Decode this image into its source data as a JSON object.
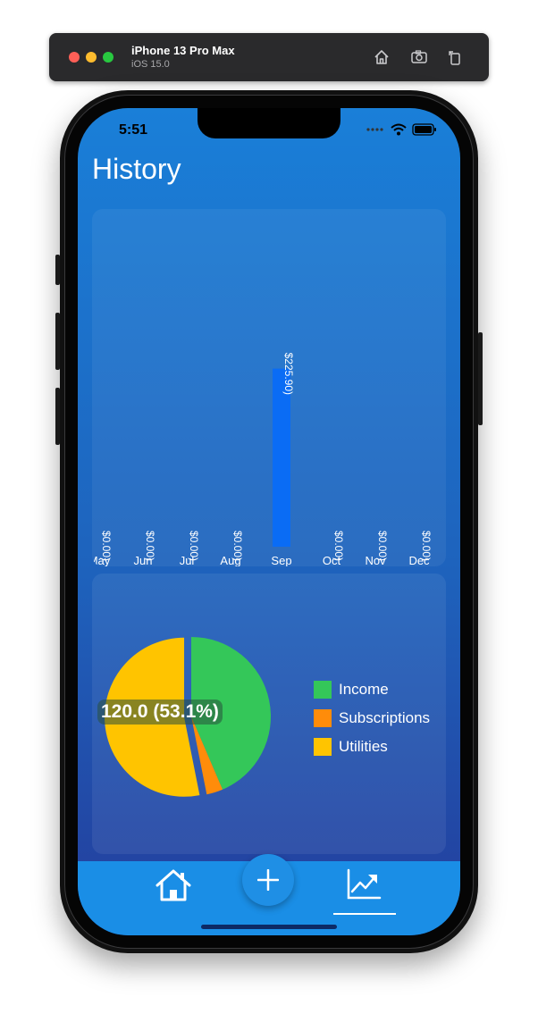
{
  "simulator": {
    "device_name": "iPhone 13 Pro Max",
    "os_version": "iOS 15.0",
    "controls": [
      "home-icon",
      "screenshot-icon",
      "rotate-icon"
    ]
  },
  "status_bar": {
    "time": "5:51",
    "icons": [
      "signal-dots-icon",
      "wifi-icon",
      "battery-icon"
    ]
  },
  "page": {
    "title": "History"
  },
  "chart_data": [
    {
      "type": "bar",
      "title": "",
      "xlabel": "",
      "ylabel": "",
      "categories": [
        "May",
        "Jun",
        "Jul",
        "Aug",
        "Sep",
        "Oct",
        "Nov",
        "Dec"
      ],
      "values": [
        0.0,
        0.0,
        0.0,
        0.0,
        225.9,
        0.0,
        0.0,
        0.0
      ],
      "value_labels": [
        "$0.00)",
        "$0.00)",
        "$0.00)",
        "$0.00)",
        "$225.90)",
        "$0.00)",
        "$0.00)",
        "$0.00)"
      ],
      "bar_color": "#0a6cf5",
      "grid": false,
      "legend": "none"
    },
    {
      "type": "pie",
      "title": "",
      "slices": [
        {
          "name": "Income",
          "value": 98.4,
          "color": "#34c759"
        },
        {
          "name": "Subscriptions",
          "value": 7.5,
          "color": "#ff8c0a"
        },
        {
          "name": "Utilities",
          "value": 120.0,
          "color": "#ffc400"
        }
      ],
      "highlighted_slice": "Utilities",
      "callout": "120.0 (53.1%)",
      "legend": "right"
    }
  ],
  "tab_bar": {
    "items": [
      {
        "icon": "house-icon",
        "selected": false
      },
      {
        "icon": "plus-icon",
        "selected": false
      },
      {
        "icon": "chart-trend-icon",
        "selected": true
      }
    ],
    "color": "#1a8ee6"
  }
}
